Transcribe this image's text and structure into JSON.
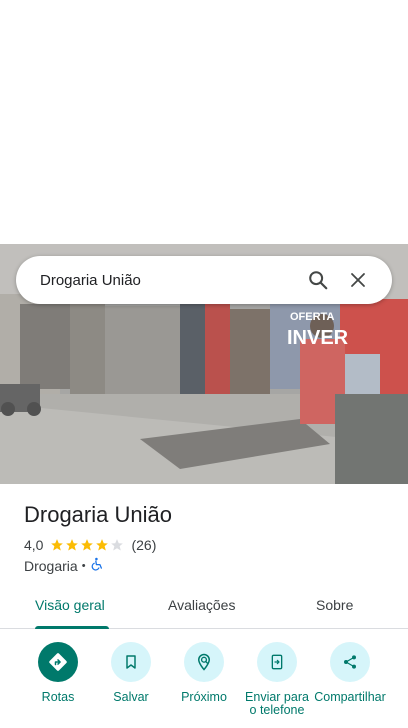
{
  "search": {
    "query": "Drogaria União"
  },
  "place": {
    "name": "Drogaria União",
    "rating": "4,0",
    "rating_value": 4.0,
    "review_count": "(26)",
    "category": "Drogaria",
    "separator": "•"
  },
  "tabs": [
    {
      "label": "Visão geral",
      "active": true
    },
    {
      "label": "Avaliações",
      "active": false
    },
    {
      "label": "Sobre",
      "active": false
    }
  ],
  "actions": [
    {
      "label": "Rotas",
      "icon": "directions-icon"
    },
    {
      "label": "Salvar",
      "icon": "bookmark-icon"
    },
    {
      "label": "Próximo",
      "icon": "nearby-icon"
    },
    {
      "label": "Enviar para o telefone",
      "icon": "send-to-phone-icon"
    },
    {
      "label": "Compartilhar",
      "icon": "share-icon"
    }
  ],
  "photo": {
    "sign_text_1": "OFERTA",
    "sign_text_2": "INVER"
  },
  "colors": {
    "accent": "#00796b",
    "action_bg": "#d6f5fa",
    "star": "#fbbc04",
    "star_empty": "#dadce0"
  }
}
